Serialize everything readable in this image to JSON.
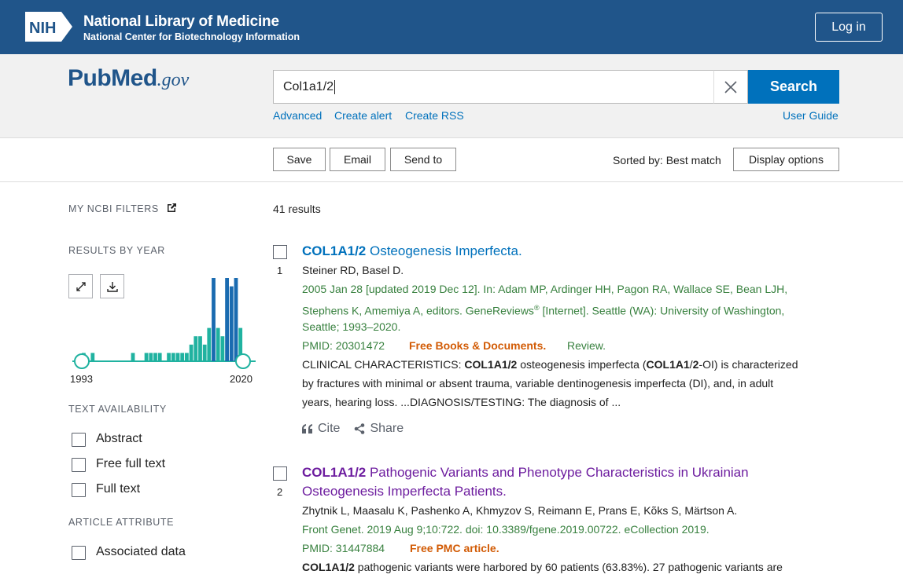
{
  "header": {
    "nih_logo_text": "NIH",
    "title": "National Library of Medicine",
    "subtitle": "National Center for Biotechnology Information",
    "login_label": "Log in"
  },
  "logo": {
    "pub": "Pub",
    "med": "Med",
    "gov": ".gov"
  },
  "search": {
    "query": "Col1a1/2",
    "button_label": "Search",
    "links": [
      "Advanced",
      "Create alert",
      "Create RSS"
    ],
    "user_guide": "User Guide"
  },
  "toolbar": {
    "save": "Save",
    "email": "Email",
    "send_to": "Send to",
    "sorted_by": "Sorted by: Best match",
    "display_options": "Display options"
  },
  "sidebar": {
    "my_filters": "MY NCBI FILTERS",
    "results_by_year": "RESULTS BY YEAR",
    "year_start": "1993",
    "year_end": "2020",
    "text_availability": "TEXT AVAILABILITY",
    "text_filters": [
      "Abstract",
      "Free full text",
      "Full text"
    ],
    "article_attribute": "ARTICLE ATTRIBUTE",
    "attribute_filters": [
      "Associated data"
    ]
  },
  "histogram": {
    "bar_color_light": "#20b2a0",
    "bar_color_dark": "#1a6bb0",
    "values": [
      1,
      0,
      1,
      0,
      0,
      0,
      0,
      0,
      0,
      0,
      0,
      1,
      0,
      0,
      1,
      1,
      1,
      1,
      0,
      1,
      1,
      1,
      1,
      1,
      2,
      3,
      3,
      2,
      4,
      10,
      4,
      3,
      10,
      9,
      10,
      4
    ]
  },
  "results": {
    "count_label": "41 results",
    "items": [
      {
        "num": "1",
        "title_bold": "COL1A1/2",
        "title_rest": " Osteogenesis Imperfecta.",
        "authors": "Steiner RD, Basel D.",
        "citation_1": "2005 Jan 28 [updated 2019 Dec 12]. In: Adam MP, Ardinger HH, Pagon RA, Wallace SE, Bean LJH,",
        "citation_2a": "Stephens K, Amemiya A, editors. GeneReviews",
        "citation_2sup": "®",
        "citation_2b": " [Internet]. Seattle (WA): University of Washington,",
        "citation_3": "Seattle; 1993–2020.",
        "pmid": "PMID: 20301472",
        "free": "Free Books & Documents.",
        "type": "Review.",
        "snippet_1a": "CLINICAL CHARACTERISTICS: ",
        "snippet_1b": "COL1A1/2",
        "snippet_1c": " osteogenesis imperfecta (",
        "snippet_1d": "COL1A1",
        "snippet_1e": "/",
        "snippet_1f": "2",
        "snippet_1g": "-OI) is characterized",
        "snippet_2": "by fractures with minimal or absent trauma, variable dentinogenesis imperfecta (DI), and, in adult",
        "snippet_3": "years, hearing loss. ...DIAGNOSIS/TESTING: The diagnosis of ...",
        "cite": "Cite",
        "share": "Share"
      },
      {
        "num": "2",
        "title_bold": "COL1A1/2",
        "title_rest": " Pathogenic Variants and Phenotype Characteristics in Ukrainian",
        "title_line2": "Osteogenesis Imperfecta Patients.",
        "authors": "Zhytnik L, Maasalu K, Pashenko A, Khmyzov S, Reimann E, Prans E, Kõks S, Märtson A.",
        "citation_1": "Front Genet. 2019 Aug 9;10:722. doi: 10.3389/fgene.2019.00722. eCollection 2019.",
        "pmid": "PMID: 31447884",
        "free": "Free PMC article.",
        "snippet_1a": "COL1A1/2",
        "snippet_1b": " pathogenic variants were harbored by 60 patients (63.83%). 27 pathogenic variants are"
      }
    ]
  }
}
